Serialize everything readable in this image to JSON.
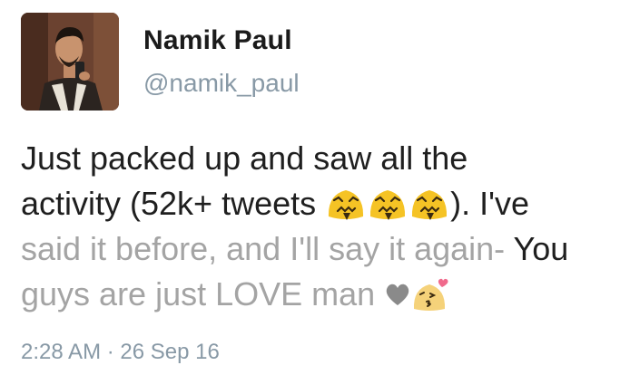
{
  "author": {
    "name": "Namik Paul",
    "handle": "@namik_paul"
  },
  "tweet": {
    "line1": "Just packed up and saw all the",
    "line2_start": "activity (52k+ tweets ",
    "line2_end": "). I've",
    "line3_faded": "said it before, and I'll say it again- ",
    "line3_dark": "You",
    "line4": "guys are just LOVE man",
    "emoji_sequence": [
      "confounded-face-icon",
      "confounded-face-icon",
      "confounded-face-icon"
    ],
    "trailing_icons": [
      "heart-icon",
      "kissing-face-icon"
    ]
  },
  "timestamp": "2:28 AM · 26 Sep 16",
  "colors": {
    "text": "#1f1f1f",
    "muted": "#8899a6",
    "faded_text": "#a4a4a4",
    "emoji_yellow": "#f5c325",
    "heart": "#8a8a8a"
  }
}
